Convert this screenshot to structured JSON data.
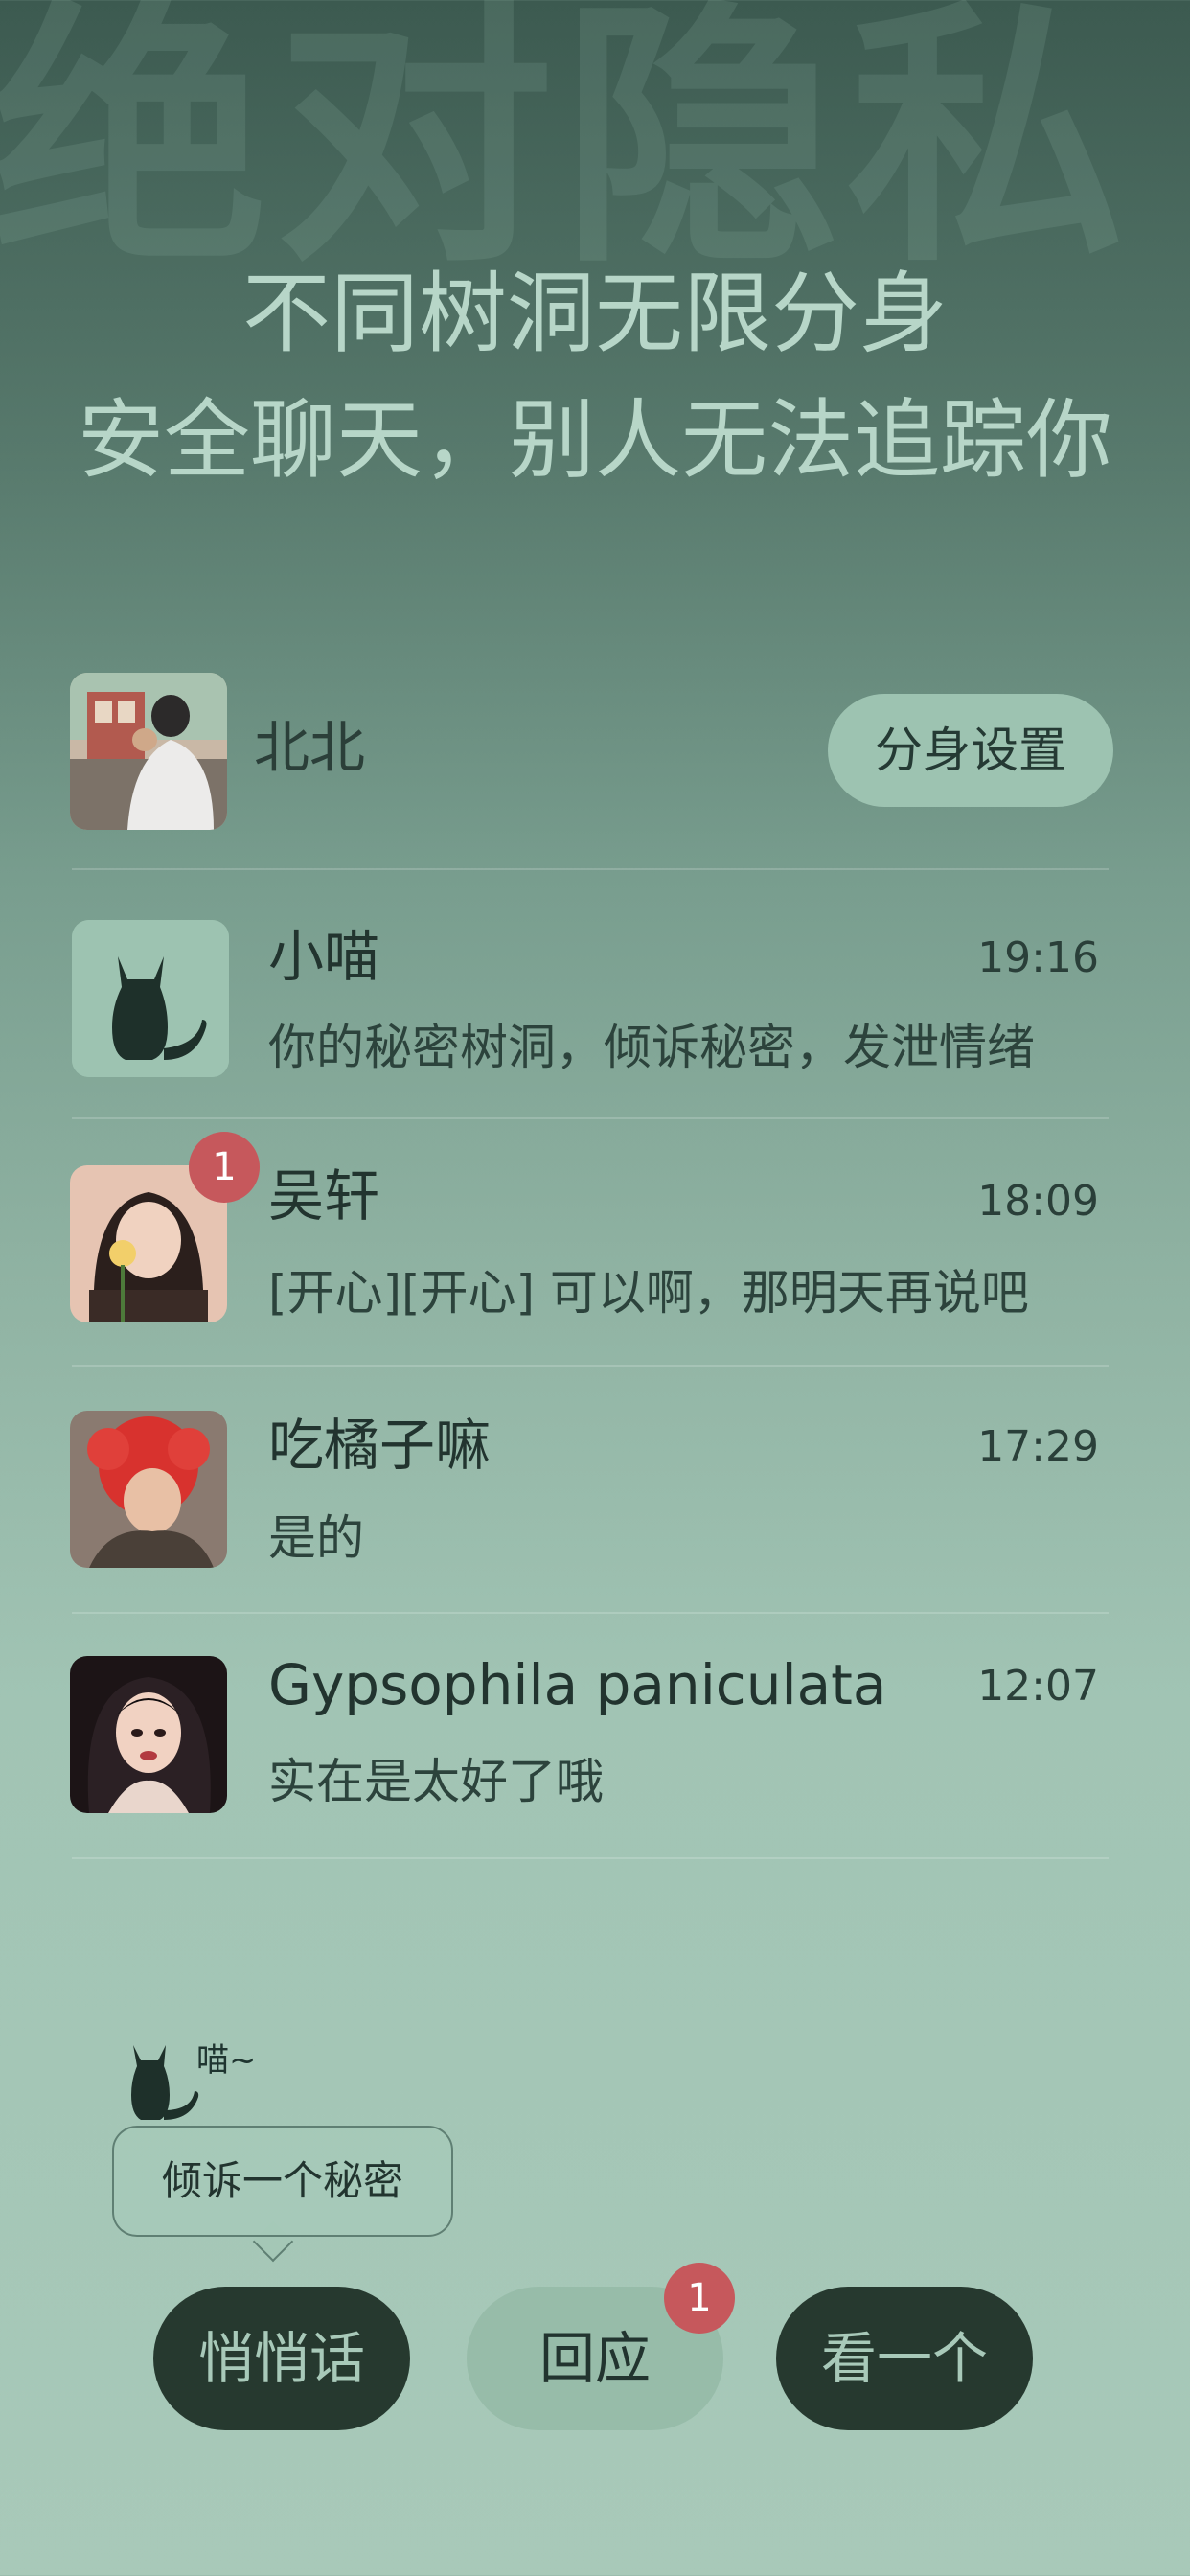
{
  "header": {
    "watermark": "绝对隐私",
    "headline_1": "不同树洞无限分身",
    "headline_2": "安全聊天，别人无法追踪你"
  },
  "self": {
    "name": "北北",
    "clone_settings_label": "分身设置"
  },
  "chats": [
    {
      "name": "小喵",
      "time": "19:16",
      "message": "你的秘密树洞，倾诉秘密，发泄情绪",
      "badge": "",
      "avatar": "cat-icon"
    },
    {
      "name": "吴轩",
      "time": "18:09",
      "message": "[开心][开心] 可以啊，那明天再说吧",
      "badge": "1",
      "avatar": "photo"
    },
    {
      "name": "吃橘子嘛",
      "time": "17:29",
      "message": "是的",
      "badge": "",
      "avatar": "photo"
    },
    {
      "name": "Gypsophila paniculata",
      "time": "12:07",
      "message": "实在是太好了哦",
      "badge": "",
      "avatar": "illustration"
    }
  ],
  "mascot": {
    "meow": "喵~",
    "tooltip": "倾诉一个秘密"
  },
  "bottom_bar": {
    "whisper_label": "悄悄话",
    "reply_label": "回应",
    "reply_badge": "1",
    "look_label": "看一个"
  },
  "colors": {
    "accent_dark": "#26392f",
    "accent_light": "#97bca9",
    "badge": "#c6585c"
  }
}
